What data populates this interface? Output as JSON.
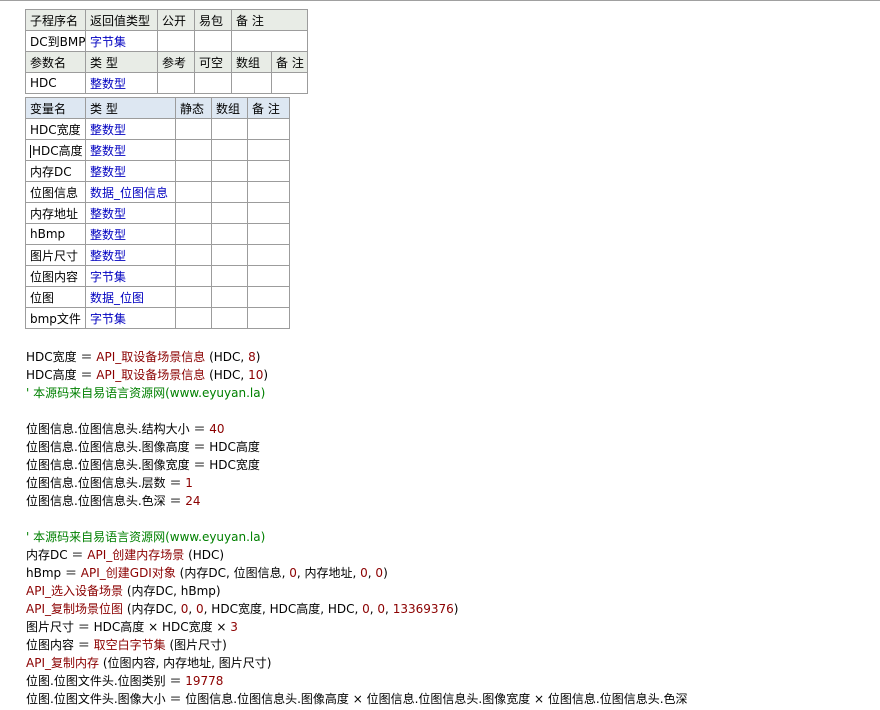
{
  "sub_table": {
    "header": [
      "子程序名",
      "返回值类型",
      "公开",
      "易包",
      "备 注"
    ],
    "row": [
      "DC到BMP",
      "字节集",
      "",
      "",
      ""
    ],
    "param_header": [
      "参数名",
      "类 型",
      "参考",
      "可空",
      "数组",
      "备 注"
    ],
    "param_row": [
      "HDC",
      "整数型",
      "",
      "",
      "",
      ""
    ]
  },
  "var_table": {
    "header": [
      "变量名",
      "类 型",
      "静态",
      "数组",
      "备 注"
    ],
    "rows": [
      [
        "HDC宽度",
        "整数型"
      ],
      [
        "HDC高度",
        "整数型"
      ],
      [
        "内存DC",
        "整数型"
      ],
      [
        "位图信息",
        "数据_位图信息"
      ],
      [
        "内存地址",
        "整数型"
      ],
      [
        "hBmp",
        "整数型"
      ],
      [
        "图片尺寸",
        "整数型"
      ],
      [
        "位图内容",
        "字节集"
      ],
      [
        "位图",
        "数据_位图"
      ],
      [
        "bmp文件",
        "字节集"
      ]
    ]
  },
  "code_lines": [
    [
      {
        "t": "HDC宽度 ＝ ",
        "c": ""
      },
      {
        "t": "API_取设备场景信息",
        "c": "fn"
      },
      {
        "t": " (HDC, ",
        "c": ""
      },
      {
        "t": "8",
        "c": "num"
      },
      {
        "t": ")",
        "c": ""
      }
    ],
    [
      {
        "t": "HDC高度 ＝ ",
        "c": ""
      },
      {
        "t": "API_取设备场景信息",
        "c": "fn"
      },
      {
        "t": " (HDC, ",
        "c": ""
      },
      {
        "t": "10",
        "c": "num"
      },
      {
        "t": ")",
        "c": ""
      }
    ],
    [
      {
        "t": "' 本源码来自易语言资源网(www.eyuyan.la)",
        "c": "cmt"
      }
    ],
    [],
    [
      {
        "t": "位图信息.位图信息头.结构大小 ＝ ",
        "c": ""
      },
      {
        "t": "40",
        "c": "num"
      }
    ],
    [
      {
        "t": "位图信息.位图信息头.图像高度 ＝ HDC高度",
        "c": ""
      }
    ],
    [
      {
        "t": "位图信息.位图信息头.图像宽度 ＝ HDC宽度",
        "c": ""
      }
    ],
    [
      {
        "t": "位图信息.位图信息头.层数 ＝ ",
        "c": ""
      },
      {
        "t": "1",
        "c": "num"
      }
    ],
    [
      {
        "t": "位图信息.位图信息头.色深 ＝ ",
        "c": ""
      },
      {
        "t": "24",
        "c": "num"
      }
    ],
    [],
    [
      {
        "t": "' 本源码来自易语言资源网(www.eyuyan.la)",
        "c": "cmt"
      }
    ],
    [
      {
        "t": "内存DC ＝ ",
        "c": ""
      },
      {
        "t": "API_创建内存场景",
        "c": "fn"
      },
      {
        "t": " (HDC)",
        "c": ""
      }
    ],
    [
      {
        "t": "hBmp ＝ ",
        "c": ""
      },
      {
        "t": "API_创建GDI对象",
        "c": "fn"
      },
      {
        "t": " (内存DC, 位图信息, ",
        "c": ""
      },
      {
        "t": "0",
        "c": "num"
      },
      {
        "t": ", 内存地址, ",
        "c": ""
      },
      {
        "t": "0",
        "c": "num"
      },
      {
        "t": ", ",
        "c": ""
      },
      {
        "t": "0",
        "c": "num"
      },
      {
        "t": ")",
        "c": ""
      }
    ],
    [
      {
        "t": "API_选入设备场景",
        "c": "fn"
      },
      {
        "t": " (内存DC, hBmp)",
        "c": ""
      }
    ],
    [
      {
        "t": "API_复制场景位图",
        "c": "fn"
      },
      {
        "t": " (内存DC, ",
        "c": ""
      },
      {
        "t": "0",
        "c": "num"
      },
      {
        "t": ", ",
        "c": ""
      },
      {
        "t": "0",
        "c": "num"
      },
      {
        "t": ", HDC宽度, HDC高度, HDC, ",
        "c": ""
      },
      {
        "t": "0",
        "c": "num"
      },
      {
        "t": ", ",
        "c": ""
      },
      {
        "t": "0",
        "c": "num"
      },
      {
        "t": ", ",
        "c": ""
      },
      {
        "t": "13369376",
        "c": "num"
      },
      {
        "t": ")",
        "c": ""
      }
    ],
    [
      {
        "t": "图片尺寸 ＝ HDC高度 × HDC宽度 × ",
        "c": ""
      },
      {
        "t": "3",
        "c": "num"
      }
    ],
    [
      {
        "t": "位图内容 ＝ ",
        "c": ""
      },
      {
        "t": "取空白字节集",
        "c": "fn"
      },
      {
        "t": " (图片尺寸)",
        "c": ""
      }
    ],
    [
      {
        "t": "API_复制内存",
        "c": "fn"
      },
      {
        "t": " (位图内容, 内存地址, 图片尺寸)",
        "c": ""
      }
    ],
    [
      {
        "t": "位图.位图文件头.位图类别 ＝ ",
        "c": ""
      },
      {
        "t": "19778",
        "c": "num"
      }
    ],
    [
      {
        "t": "位图.位图文件头.图像大小 ＝ 位图信息.位图信息头.图像高度 × 位图信息.位图信息头.图像宽度 × 位图信息.位图信息头.色深",
        "c": ""
      }
    ]
  ]
}
